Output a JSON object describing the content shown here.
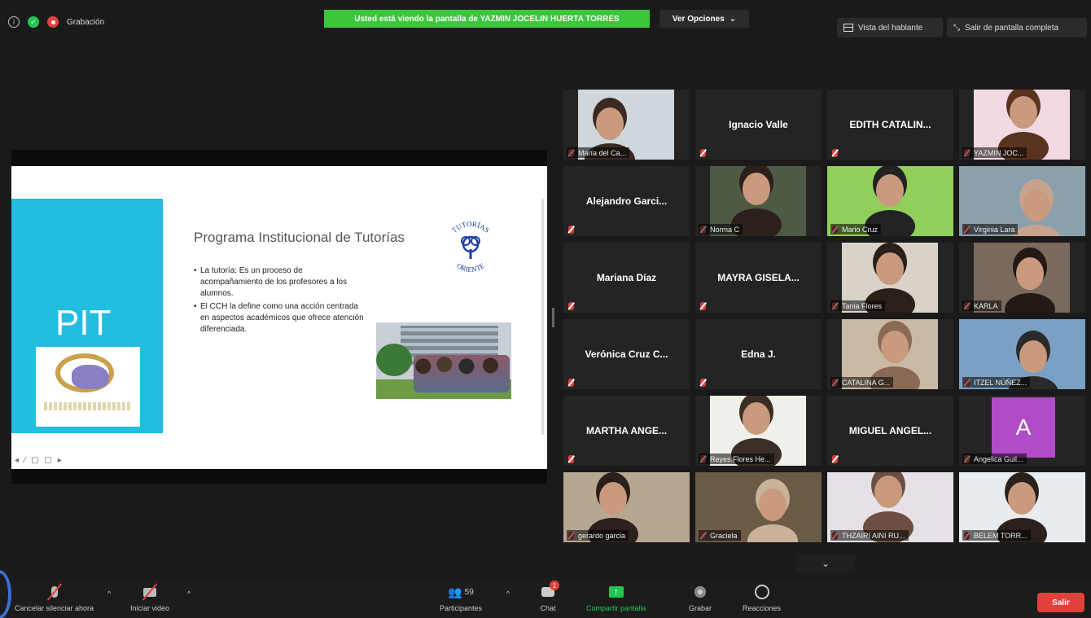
{
  "top": {
    "recording_label": "Grabación",
    "banner": "Usted está viendo la pantalla de YAZMIN JOCELIN HUERTA TORRES",
    "view_options": "Ver Opciones",
    "speaker_view": "Vista del hablante",
    "exit_fullscreen": "Salir de pantalla completa"
  },
  "slide": {
    "side_title": "PIT",
    "title": "Programa Institucional de Tutorías",
    "bullets": [
      "La tutoría: Es un proceso de acompañamiento de los profesores a los alumnos.",
      "El CCH la define como una acción centrada en aspectos académicos que ofrece atención diferenciada."
    ],
    "logo_text_top": "TUTORÍAS",
    "logo_text_bottom": "ORIENTE"
  },
  "participants": [
    {
      "name": "María del Ca...",
      "kind": "video"
    },
    {
      "name": "Ignacio Valle",
      "kind": "name"
    },
    {
      "name": "EDITH CATALIN...",
      "kind": "name"
    },
    {
      "name": "YAZMIN JOC...",
      "kind": "video"
    },
    {
      "name": "Alejandro Garci...",
      "kind": "name"
    },
    {
      "name": "Norma C",
      "kind": "video"
    },
    {
      "name": "Mario Cruz",
      "kind": "video"
    },
    {
      "name": "Virginia Lara",
      "kind": "video"
    },
    {
      "name": "Mariana Díaz",
      "kind": "name"
    },
    {
      "name": "MAYRA GISELA...",
      "kind": "name"
    },
    {
      "name": "Tania Flores",
      "kind": "video"
    },
    {
      "name": "KARLA",
      "kind": "video"
    },
    {
      "name": "Verónica Cruz C...",
      "kind": "name"
    },
    {
      "name": "Edna J.",
      "kind": "name"
    },
    {
      "name": "CATALINA G...",
      "kind": "video"
    },
    {
      "name": "ITZEL NÚÑEZ...",
      "kind": "video"
    },
    {
      "name": "MARTHA ANGE...",
      "kind": "name"
    },
    {
      "name": "Reyes Flores He...",
      "kind": "video"
    },
    {
      "name": "MIGUEL ANGEL...",
      "kind": "name"
    },
    {
      "name": "Angelica Guil...",
      "kind": "avatar",
      "initial": "A"
    },
    {
      "name": "gerardo garcia",
      "kind": "video"
    },
    {
      "name": "Graciela",
      "kind": "video"
    },
    {
      "name": "THZAIRI AINI RU...",
      "kind": "video"
    },
    {
      "name": "BELEM TORR...",
      "kind": "video"
    }
  ],
  "toolbar": {
    "mute_label": "Cancelar silenciar ahora",
    "video_label": "Iniciar video",
    "participants_label": "Participantes",
    "participants_count": "59",
    "chat_label": "Chat",
    "chat_badge": "1",
    "share_label": "Compartir pantalla",
    "record_label": "Grabar",
    "reactions_label": "Reacciones",
    "leave_label": "Salir"
  },
  "colors": {
    "banner_green": "#3ac73a",
    "share_green": "#23c552",
    "leave_red": "#e0413a",
    "slide_teal": "#23bde0",
    "active_speaker": "#e5d44a"
  }
}
